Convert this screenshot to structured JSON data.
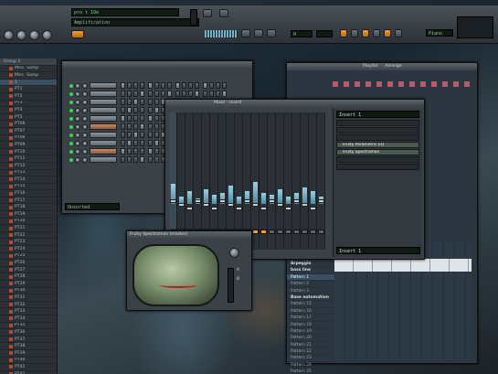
{
  "toolbar": {
    "song_title": "pro t 10e",
    "hint_text": "Amplification",
    "tempo_lcd": "0",
    "pattern_lcd": "",
    "mode_lcd": "Piano",
    "song_mode": "Line"
  },
  "browser": {
    "header": "Group 1",
    "items": [
      "Misc. Samp",
      "Misc. Samp",
      "1",
      "PT1",
      "PT2",
      "PT3",
      "PT4",
      "PT5",
      "PT06",
      "PT07",
      "PT08",
      "PT09",
      "PT10",
      "PT11",
      "PT12",
      "PT13",
      "PT14",
      "PT15",
      "PT16",
      "PT17",
      "PT18",
      "PT19",
      "PT20",
      "PT21",
      "PT22",
      "PT23",
      "PT24",
      "PT25",
      "PT26",
      "PT27",
      "PT28",
      "PT29",
      "PT30",
      "PT31",
      "PT32",
      "PT33",
      "PT34",
      "PT35",
      "PT36",
      "PT37",
      "PT38",
      "PT39",
      "PT40",
      "PT41",
      "PT42",
      "PT43"
    ]
  },
  "step_sequencer": {
    "title": "",
    "channels": [
      "",
      "",
      "",
      "",
      "",
      "",
      "",
      "",
      "",
      ""
    ],
    "footer": "Unsorted"
  },
  "mixer": {
    "title": "Mixer - Insert",
    "preset": "Insert 1",
    "slots": [
      {
        "label": "",
        "active": false
      },
      {
        "label": "",
        "active": false
      },
      {
        "label": "",
        "active": false
      },
      {
        "label": "Fruity Parametric EQ",
        "active": true
      },
      {
        "label": "Fruity Spectroman",
        "active": true
      },
      {
        "label": "",
        "active": false
      },
      {
        "label": "",
        "active": false
      }
    ],
    "out_label": "Insert 1"
  },
  "spectroman": {
    "title": "Fruity Spectroman (master)",
    "label_a": "A",
    "label_b": "B"
  },
  "playlist": {
    "title": "Playlist",
    "tab": "Arrange",
    "rows": [
      {
        "label": "Arpeggio",
        "type": "hdr"
      },
      {
        "label": "bass line",
        "type": "hdr"
      },
      {
        "label": "Pattern 1",
        "type": "sel"
      },
      {
        "label": "Pattern 2",
        "type": ""
      },
      {
        "label": "Pattern 3",
        "type": ""
      },
      {
        "label": "Base automation",
        "type": "hdr"
      },
      {
        "label": "Pattern 15",
        "type": ""
      },
      {
        "label": "Pattern 16",
        "type": ""
      },
      {
        "label": "Pattern 17",
        "type": ""
      },
      {
        "label": "Pattern 18",
        "type": ""
      },
      {
        "label": "Pattern 19",
        "type": ""
      },
      {
        "label": "Pattern 20",
        "type": ""
      },
      {
        "label": "Pattern 21",
        "type": ""
      },
      {
        "label": "Pattern 22",
        "type": ""
      },
      {
        "label": "Pattern 23",
        "type": ""
      },
      {
        "label": "Pattern 24",
        "type": ""
      },
      {
        "label": "Pattern 25",
        "type": ""
      }
    ]
  },
  "colors": {
    "accent": "#f0a030",
    "led": "#39d24a",
    "meter": "#6fb3c8"
  }
}
